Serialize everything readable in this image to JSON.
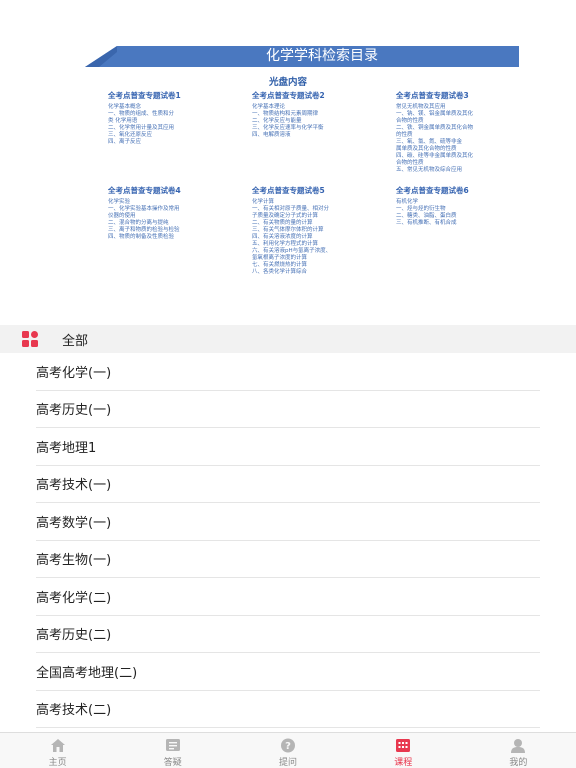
{
  "banner": {
    "title": "化学学科检索目录",
    "subtitle": "光盘内容",
    "volumes": [
      {
        "title": "全考点普查专题试卷1",
        "category": "化学基本概念",
        "items": [
          "一、物质的组成、性质和分",
          "类 化学用语",
          "二、化学常用计量及其应用",
          "三、氧化还原反应",
          "四、离子反应"
        ]
      },
      {
        "title": "全考点普查专题试卷2",
        "category": "化学基本理论",
        "items": [
          "一、物质结构和元素周期律",
          "二、化学反应与能量",
          "三、化学反应速率与化学平衡",
          "四、电解质溶液"
        ]
      },
      {
        "title": "全考点普查专题试卷3",
        "category": "常见无机物及其应用",
        "items": [
          "一、钠、镁、铝金属单质及其化",
          "合物的性质",
          "二、铁、铜金属单质及其化合物",
          "的性质",
          "三、氧、氯、氮、硫等非金",
          "属单质及其化合物的性质",
          "四、碳、硅等非金属单质及其化",
          "合物的性质",
          "五、常见无机物及综合应用"
        ]
      },
      {
        "title": "全考点普查专题试卷4",
        "category": "化学实验",
        "items": [
          "一、化学实验基本操作及常用",
          "仪器的使用",
          "二、混合物的分离与提纯",
          "三、离子和物质的检验与检验",
          "四、物质的制备及性质检验"
        ]
      },
      {
        "title": "全考点普查专题试卷5",
        "category": "化学计算",
        "items": [
          "一、有关相对原子质量、相对分",
          "子质量及确定分子式的计算",
          "二、有关物质的量的计算",
          "三、有关气体摩尔体积的计算",
          "四、有关溶液浓度的计算",
          "五、利用化学方程式的计算",
          "六、有关溶液pH与氢离子浓度、",
          "氢氧根离子浓度的计算",
          "七、有关燃烧热的计算",
          "八、各类化学计算综合"
        ]
      },
      {
        "title": "全考点普查专题试卷6",
        "category": "有机化学",
        "items": [
          "一、烃与烃的衍生物",
          "二、糖类、油脂、蛋白质",
          "三、有机推断、有机合成"
        ]
      }
    ]
  },
  "category_header": {
    "icon": "grid-icon",
    "label": "全部"
  },
  "courses": [
    "高考化学(一)",
    "高考历史(一)",
    "高考地理1",
    "高考技术(一)",
    "高考数学(一)",
    "高考生物(一)",
    "高考化学(二)",
    "高考历史(二)",
    "全国高考地理(二)",
    "高考技术(二)"
  ],
  "tabbar": {
    "active_color": "#e8384f",
    "tabs": [
      {
        "label": "主页",
        "icon": "home-icon",
        "active": false
      },
      {
        "label": "答疑",
        "icon": "message-icon",
        "active": false
      },
      {
        "label": "提问",
        "icon": "question-icon",
        "active": false
      },
      {
        "label": "课程",
        "icon": "course-icon",
        "active": true
      },
      {
        "label": "我的",
        "icon": "user-icon",
        "active": false
      }
    ]
  }
}
